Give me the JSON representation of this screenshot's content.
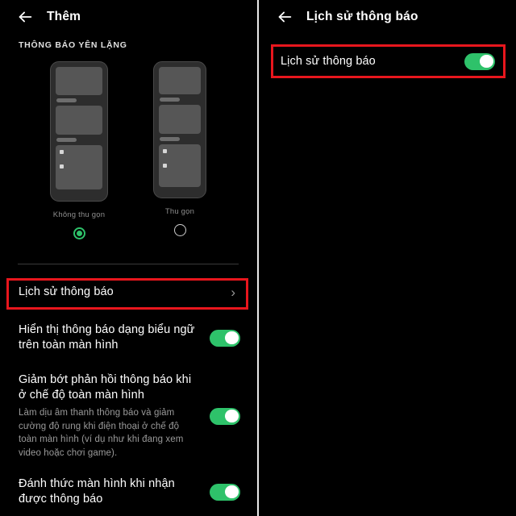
{
  "colors": {
    "background": "#000000",
    "accent_green": "#2ec26a",
    "annotation_red": "#e8161d",
    "text_primary": "#ffffff",
    "text_secondary": "#9a9a9a"
  },
  "left_panel": {
    "appbar": {
      "back_icon": "arrow-left-icon",
      "title": "Thêm"
    },
    "section_label": "THÔNG BÁO YÊN LẶNG",
    "options": [
      {
        "label": "Không thu gọn",
        "selected": true
      },
      {
        "label": "Thu gọn",
        "selected": false
      }
    ],
    "rows": [
      {
        "title": "Lịch sử thông báo",
        "subtitle": "",
        "control": "chevron",
        "chevron": "›",
        "highlighted": true
      },
      {
        "title": "Hiển thị thông báo dạng biểu ngữ trên toàn màn hình",
        "subtitle": "",
        "control": "toggle",
        "toggle_on": true,
        "highlighted": false
      },
      {
        "title": "Giảm bớt phản hồi thông báo khi ở chế độ toàn màn hình",
        "subtitle": "Làm dịu âm thanh thông báo và giảm cường độ rung khi điện thoại ở chế độ toàn màn hình (ví dụ như khi đang xem video hoặc chơi game).",
        "control": "toggle",
        "toggle_on": true,
        "highlighted": false
      },
      {
        "title": "Đánh thức màn hình khi nhận được thông báo",
        "subtitle": "",
        "control": "toggle",
        "toggle_on": true,
        "highlighted": false
      }
    ]
  },
  "right_panel": {
    "appbar": {
      "back_icon": "arrow-left-icon",
      "title": "Lịch sử thông báo"
    },
    "row": {
      "title": "Lịch sử thông báo",
      "control": "toggle",
      "toggle_on": true,
      "highlighted": true
    }
  }
}
